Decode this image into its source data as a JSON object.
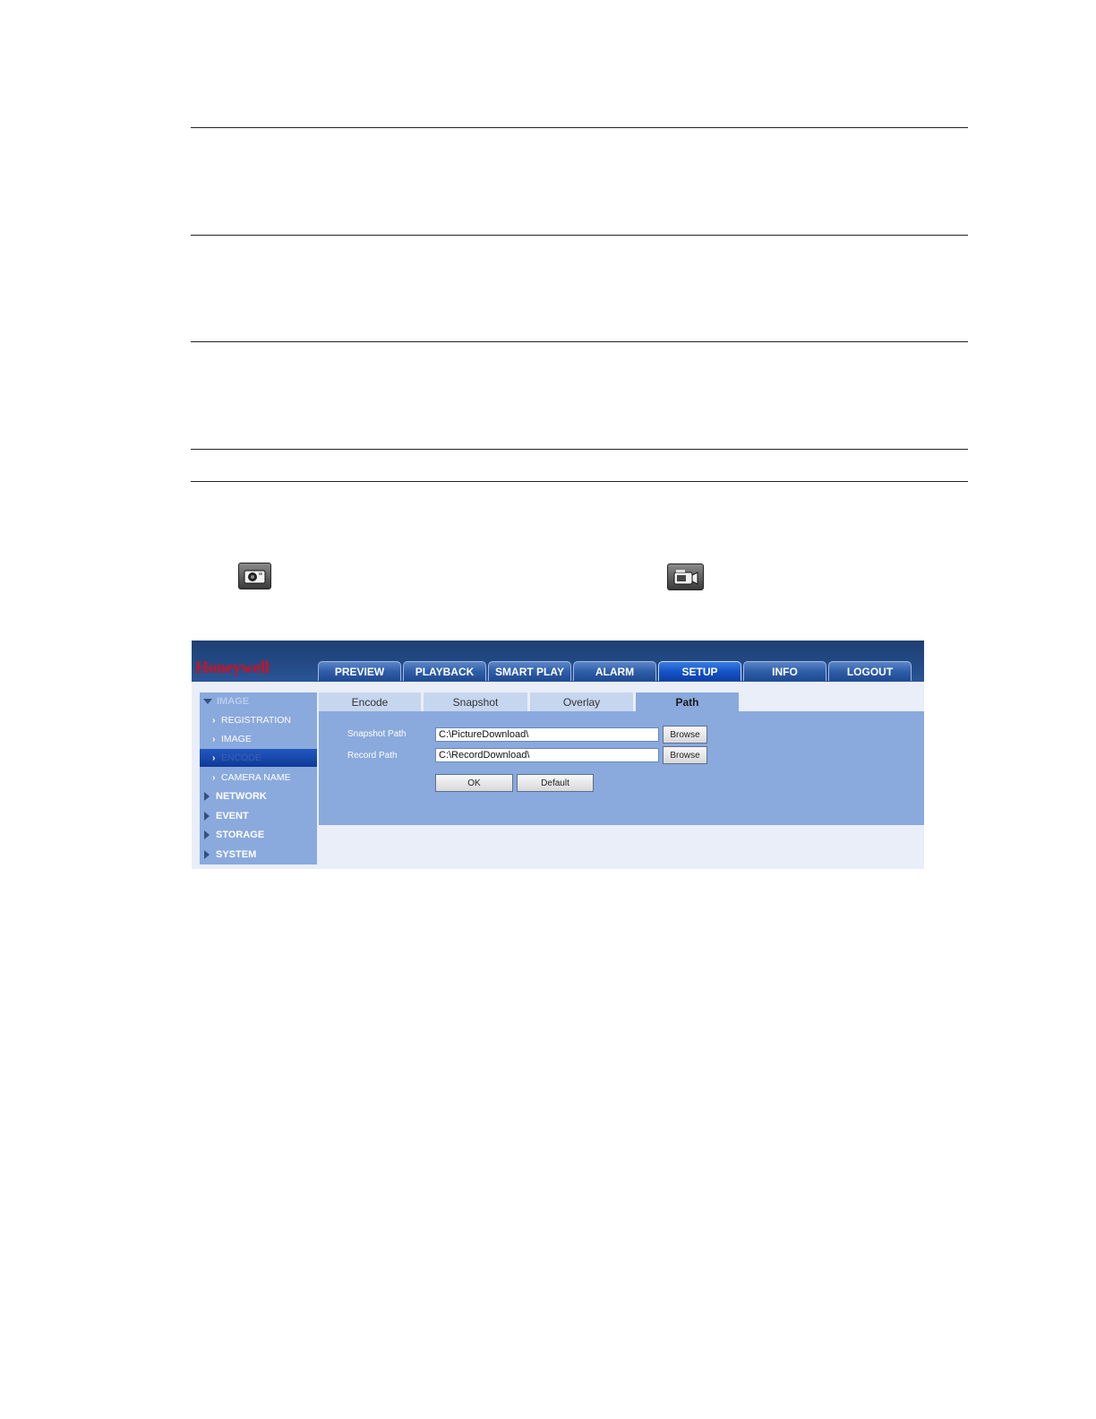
{
  "app": {
    "brand": "Honeywell",
    "nav": [
      {
        "label": "PREVIEW"
      },
      {
        "label": "PLAYBACK"
      },
      {
        "label": "SMART PLAY"
      },
      {
        "label": "ALARM"
      },
      {
        "label": "SETUP",
        "active": true
      },
      {
        "label": "INFO"
      },
      {
        "label": "LOGOUT"
      }
    ],
    "sidebar": {
      "section": "IMAGE",
      "sub": [
        {
          "label": "REGISTRATION"
        },
        {
          "label": "IMAGE"
        },
        {
          "label": "ENCODE",
          "selected": true
        },
        {
          "label": "CAMERA NAME"
        }
      ],
      "top": [
        {
          "label": "NETWORK"
        },
        {
          "label": "EVENT"
        },
        {
          "label": "STORAGE"
        },
        {
          "label": "SYSTEM"
        }
      ]
    },
    "tabs": [
      {
        "label": "Encode"
      },
      {
        "label": "Snapshot"
      },
      {
        "label": "Overlay"
      },
      {
        "label": "Path",
        "active": true
      }
    ],
    "form": {
      "snapshot_label": "Snapshot Path",
      "snapshot_value": "C:\\PictureDownload\\",
      "record_label": "Record Path",
      "record_value": "C:\\RecordDownload\\",
      "browse_label": "Browse",
      "ok_label": "OK",
      "default_label": "Default"
    }
  },
  "icons": {
    "snapshot": "camera-icon",
    "record": "video-camera-icon"
  },
  "colors": {
    "accent_red": "#d0101c",
    "header_blue": "#234a85",
    "panel_blue": "#8aa9dd",
    "selected_blue": "#1554c8"
  }
}
